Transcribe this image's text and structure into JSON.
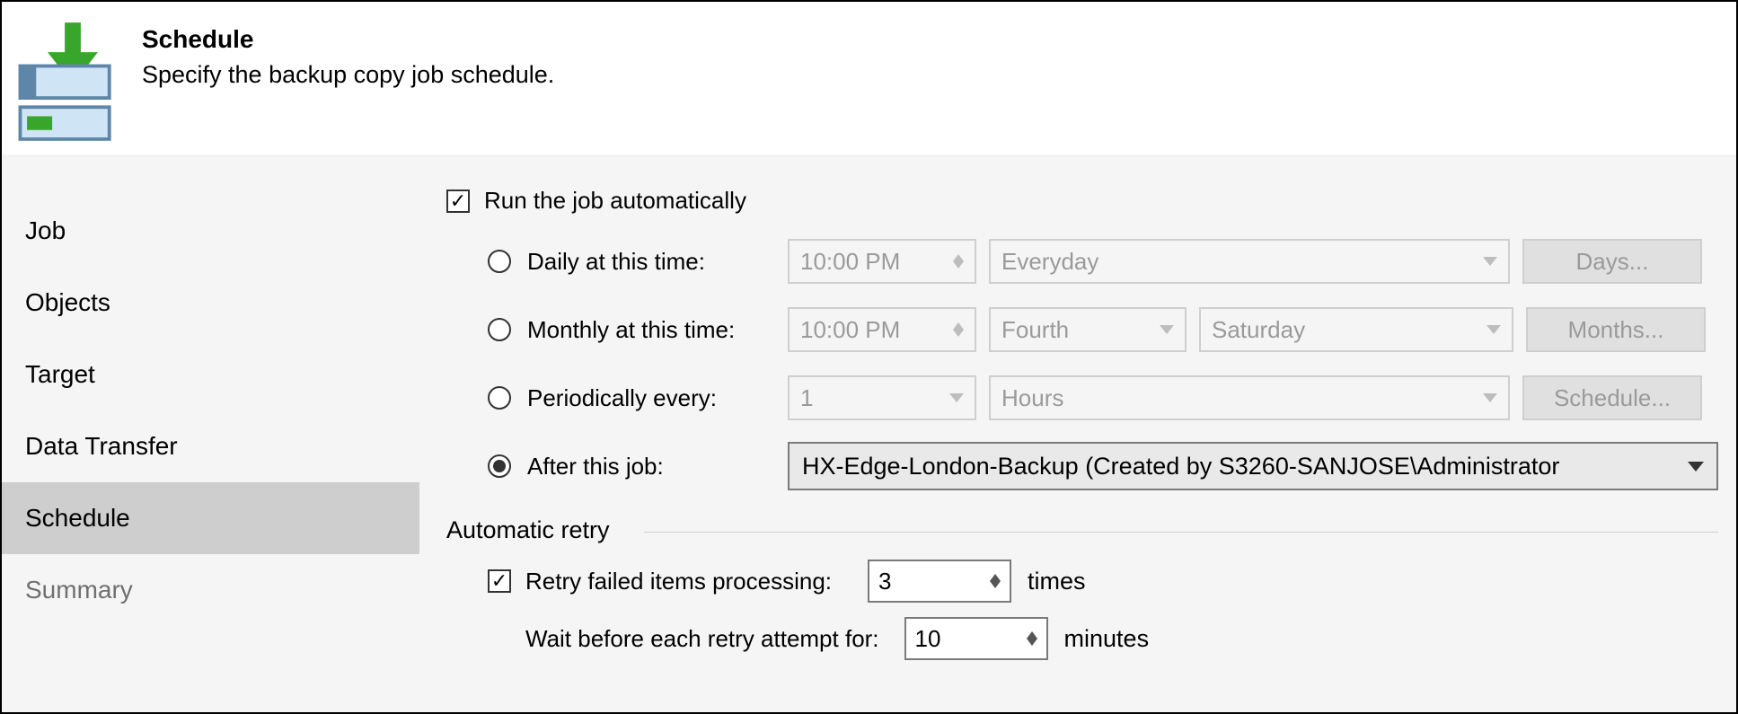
{
  "header": {
    "title": "Schedule",
    "subtitle": "Specify the backup copy job schedule."
  },
  "sidebar": {
    "items": [
      {
        "label": "Job"
      },
      {
        "label": "Objects"
      },
      {
        "label": "Target"
      },
      {
        "label": "Data Transfer"
      },
      {
        "label": "Schedule"
      },
      {
        "label": "Summary"
      }
    ]
  },
  "run_auto": {
    "label": "Run the job automatically",
    "checked": true
  },
  "daily": {
    "label": "Daily at this time:",
    "time": "10:00 PM",
    "days_select": "Everyday",
    "days_button": "Days..."
  },
  "monthly": {
    "label": "Monthly at this time:",
    "time": "10:00 PM",
    "ordinal": "Fourth",
    "weekday": "Saturday",
    "months_button": "Months..."
  },
  "periodic": {
    "label": "Periodically every:",
    "value": "1",
    "unit": "Hours",
    "schedule_button": "Schedule..."
  },
  "after": {
    "label": "After this job:",
    "value": "HX-Edge-London-Backup (Created by S3260-SANJOSE\\Administrator"
  },
  "retry": {
    "legend": "Automatic retry",
    "enable_label": "Retry failed items processing:",
    "enable_checked": true,
    "count": "3",
    "count_unit": "times",
    "wait_label": "Wait before each retry attempt for:",
    "wait_value": "10",
    "wait_unit": "minutes"
  }
}
